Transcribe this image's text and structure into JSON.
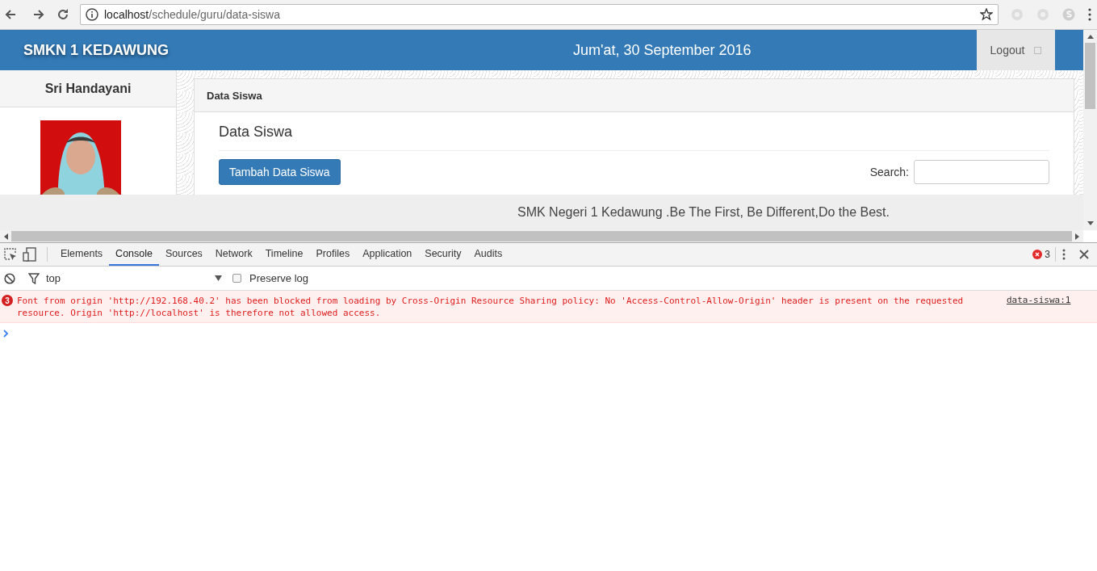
{
  "browser": {
    "url_host": "localhost",
    "url_path": "/schedule/guru/data-siswa"
  },
  "header": {
    "brand": "SMKN 1 KEDAWUNG",
    "date": "Jum'at, 30 September 2016",
    "logout": "Logout"
  },
  "sidebar": {
    "name": "Sri Handayani"
  },
  "panel": {
    "heading": "Data Siswa",
    "title": "Data Siswa",
    "add_button": "Tambah Data Siswa",
    "search_label": "Search:"
  },
  "footer": {
    "text": "SMK Negeri 1 Kedawung .Be The First, Be Different,Do the Best."
  },
  "devtools": {
    "tabs": [
      {
        "label": "Elements",
        "selected": false
      },
      {
        "label": "Console",
        "selected": true
      },
      {
        "label": "Sources",
        "selected": false
      },
      {
        "label": "Network",
        "selected": false
      },
      {
        "label": "Timeline",
        "selected": false
      },
      {
        "label": "Profiles",
        "selected": false
      },
      {
        "label": "Application",
        "selected": false
      },
      {
        "label": "Security",
        "selected": false
      },
      {
        "label": "Audits",
        "selected": false
      }
    ],
    "error_count": "3",
    "context": "top",
    "preserve_log": {
      "label": "Preserve log",
      "checked": false
    },
    "messages": [
      {
        "count": "3",
        "text": "Font from origin 'http://192.168.40.2' has been blocked from loading by Cross-Origin Resource Sharing policy: No 'Access-Control-Allow-Origin' header is present on the requested resource. Origin 'http://localhost' is therefore not allowed access.",
        "source": "data-siswa:1"
      }
    ]
  }
}
